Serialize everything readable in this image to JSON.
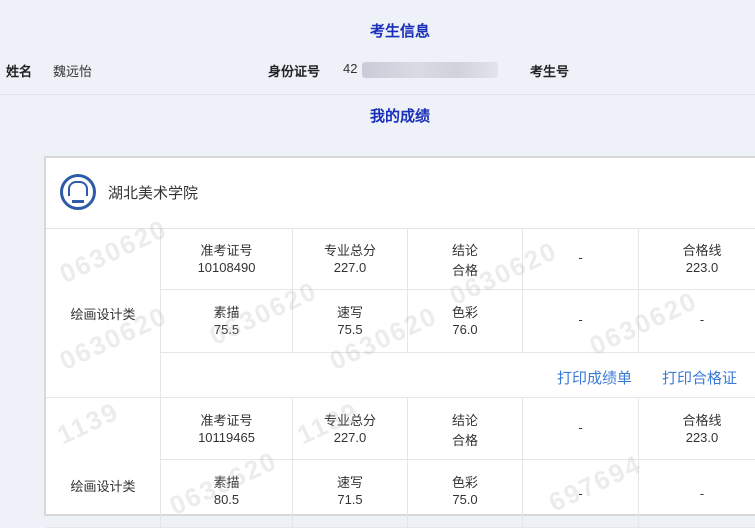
{
  "headers": {
    "candidate_info": "考生信息",
    "my_scores": "我的成绩"
  },
  "candidate": {
    "name_label": "姓名",
    "name_value": "魏远怡",
    "id_label": "身份证号",
    "id_prefix": "42",
    "exam_no_label": "考生号"
  },
  "school": {
    "name": "湖北美术学院"
  },
  "records": [
    {
      "category": "绘画设计类",
      "admission_label": "准考证号",
      "admission_no": "10108490",
      "total_label": "专业总分",
      "total": "227.0",
      "result_label": "结论",
      "result": "合格",
      "dash1": "-",
      "pass_label": "合格线",
      "pass_line": "223.0",
      "sketch_label": "素描",
      "sketch": "75.5",
      "quick_label": "速写",
      "quick": "75.5",
      "color_label": "色彩",
      "color": "76.0",
      "dash2": "-",
      "dash3": "-",
      "print_scores": "打印成绩单",
      "print_cert": "打印合格证"
    },
    {
      "category": "绘画设计类",
      "admission_label": "准考证号",
      "admission_no": "10119465",
      "total_label": "专业总分",
      "total": "227.0",
      "result_label": "结论",
      "result": "合格",
      "dash1": "-",
      "pass_label": "合格线",
      "pass_line": "223.0",
      "sketch_label": "素描",
      "sketch": "80.5",
      "quick_label": "速写",
      "quick": "71.5",
      "color_label": "色彩",
      "color": "75.0",
      "dash2": "-",
      "dash3": "-"
    }
  ],
  "watermarks": [
    "0630620",
    "0630620",
    "0630620",
    "0630620",
    "0630620",
    "0630620",
    "1139",
    "697694",
    "1139",
    "0630620"
  ]
}
